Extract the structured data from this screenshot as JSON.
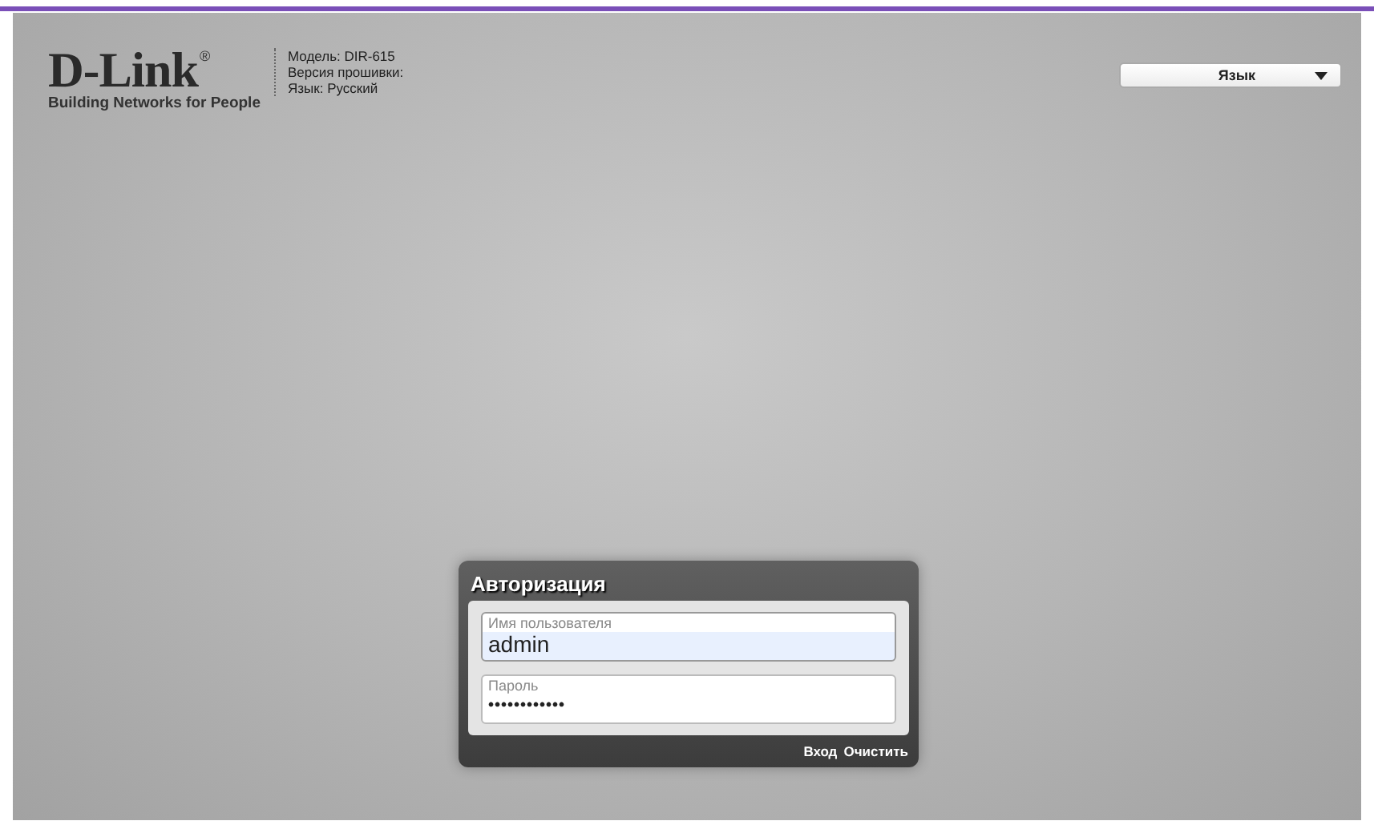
{
  "logo": {
    "brand": "D-Link",
    "mark": "®",
    "tagline": "Building Networks for People"
  },
  "device_info": [
    "Модель: DIR-615",
    "Версия прошивки:",
    "Язык: Русский"
  ],
  "language_select": {
    "value": "Язык"
  },
  "login": {
    "title": "Авторизация",
    "fields": [
      {
        "label": "Имя пользователя",
        "value": "admin",
        "focused": true
      },
      {
        "label": "Пароль",
        "value": "••••••••••••",
        "focused": false
      }
    ],
    "buttons": [
      "Вход",
      "Очистить"
    ]
  }
}
